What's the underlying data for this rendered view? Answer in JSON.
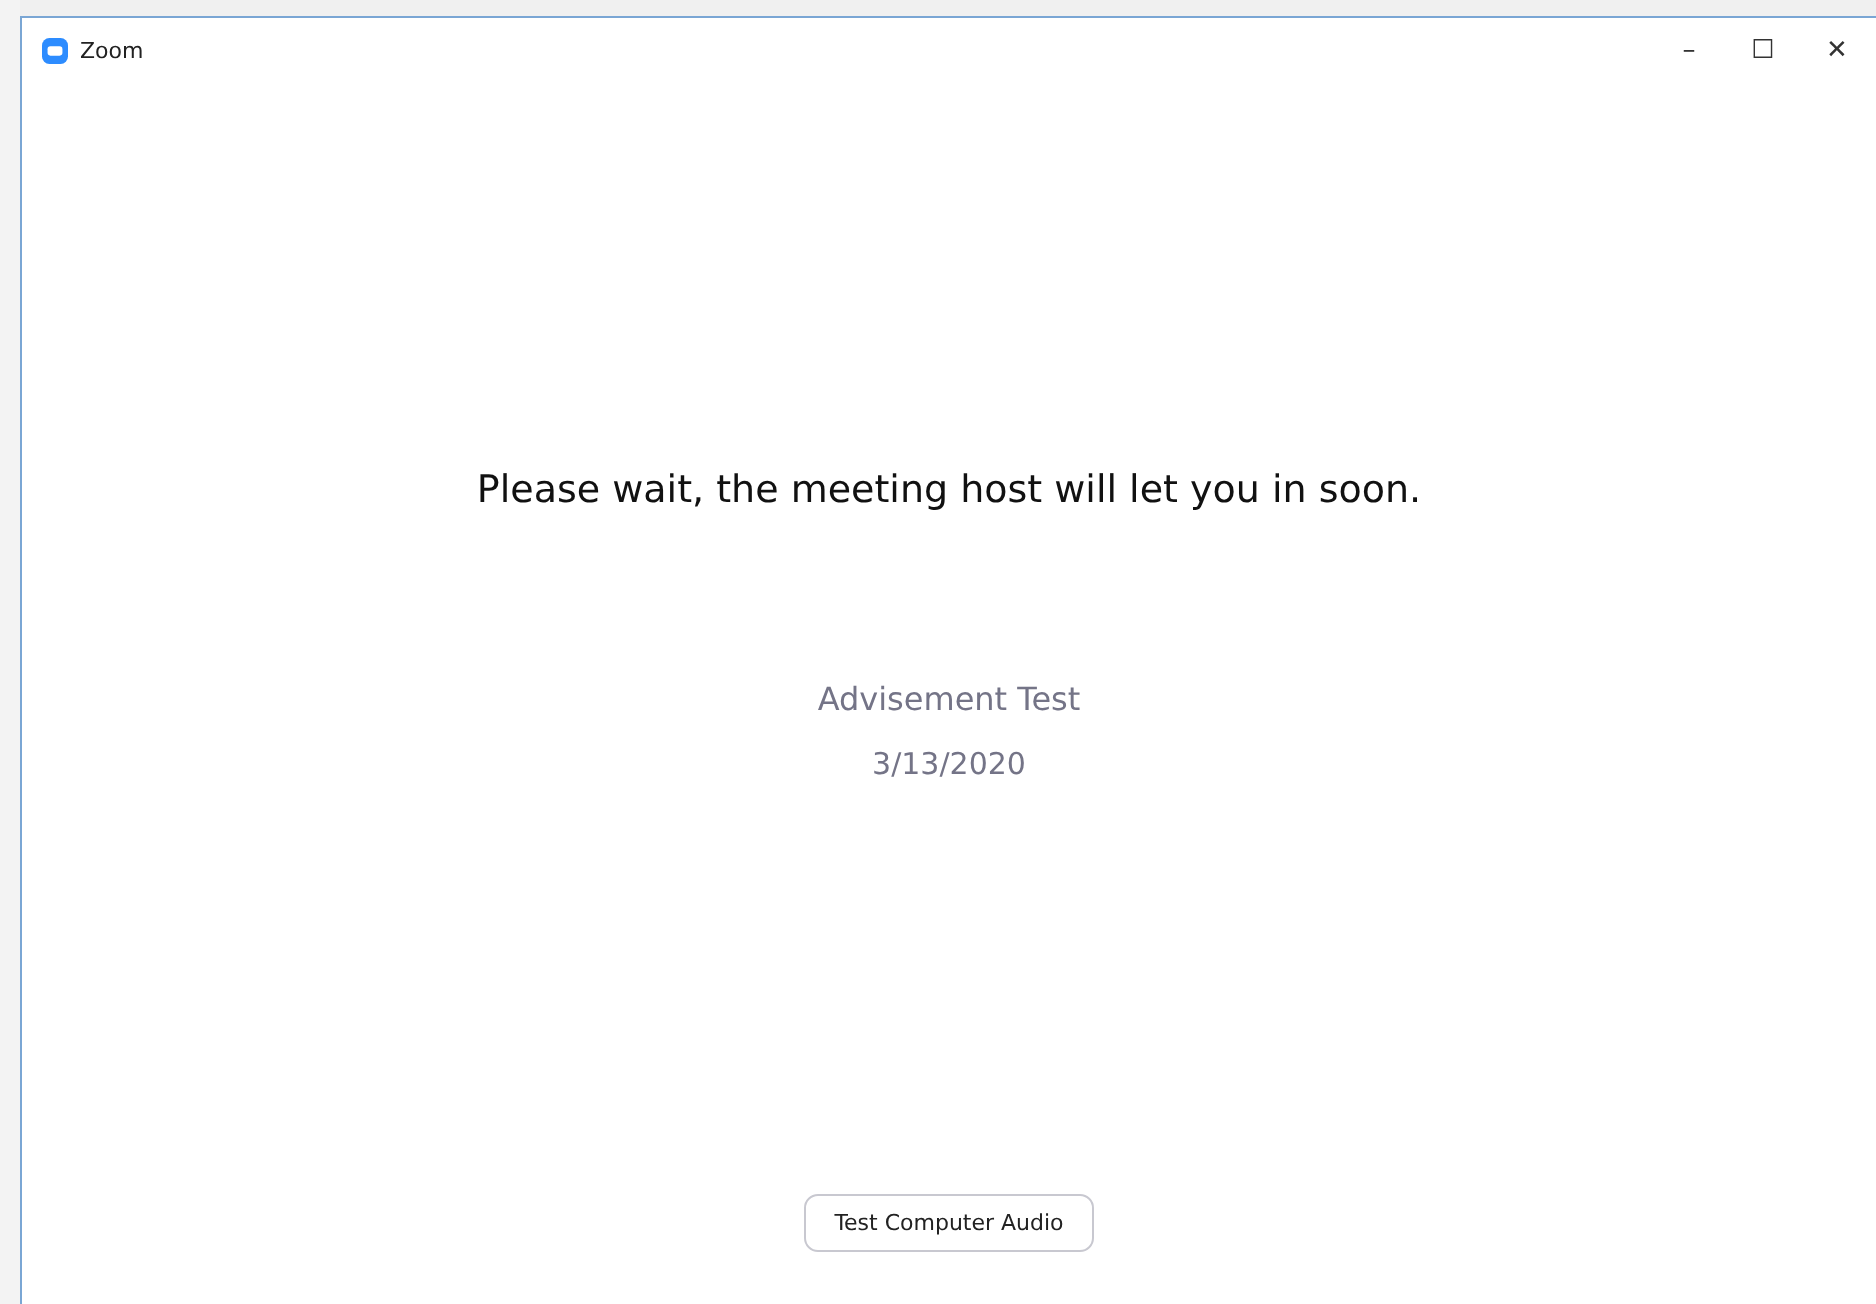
{
  "window": {
    "title": "Zoom",
    "controls": [
      "–",
      "☐",
      "✕"
    ]
  },
  "message": "Please wait, the meeting host will let you in soon.",
  "meeting": {
    "topic": "Advisement Test",
    "date": "3/13/2020"
  },
  "buttons": [
    "Test Computer Audio"
  ]
}
